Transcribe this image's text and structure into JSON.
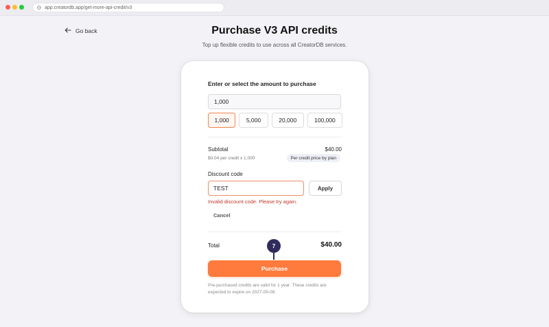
{
  "browser": {
    "url": "app.creatordb.app/get-more-api-credit/v3",
    "lock_icon": "lock-icon"
  },
  "header": {
    "back_label": "Go back",
    "back_icon": "arrow-left-icon",
    "title": "Purchase V3 API credits",
    "subtitle": "Top up flexible credits to use across all CreatorDB services."
  },
  "form": {
    "amount_prompt": "Enter or select the amount to purchase",
    "amount_value": "1,000",
    "presets": [
      "1,000",
      "5,000",
      "20,000",
      "100,000"
    ],
    "selected_preset": "1,000",
    "subtotal_label": "Subtotal",
    "subtotal_value": "$40.00",
    "per_credit_text": "$0.04 per credit x 1,000",
    "plan_badge": "Per credit price by plan",
    "discount_label": "Discount code",
    "discount_value": "TEST",
    "apply_label": "Apply",
    "error_text": "Invalid discount code. Please try again.",
    "cancel_label": "Cancel",
    "total_label": "Total",
    "total_value": "$40.00",
    "step_number": "7",
    "purchase_label": "Purchase",
    "footnote": "Pre-purchased credits are valid for 1 year. These credits are expected to expire on 2027-09-08."
  },
  "colors": {
    "accent": "#ff7a3d",
    "error": "#c0392b",
    "marker": "#2f2c5c"
  }
}
